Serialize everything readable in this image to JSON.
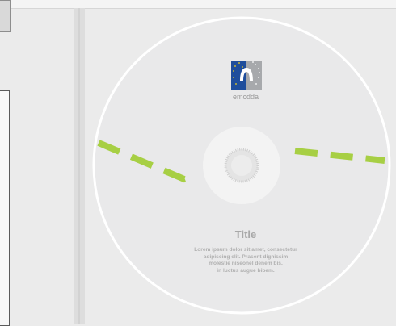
{
  "disc": {
    "title": "Title",
    "body_lines": [
      "Lorem ipsum dolor sit amet, consectetur",
      "adipiscing elit. Prasent dignissim",
      "molestie niseonel denem bis,",
      "in luctus augue bibem."
    ],
    "logo_text": "emcdda"
  },
  "colors": {
    "background": "#ebebeb",
    "disc": "#e9e9ea",
    "dash": "#a7cf44",
    "logo_blue": "#1f4e9c",
    "logo_grey": "#a7a9ac"
  }
}
